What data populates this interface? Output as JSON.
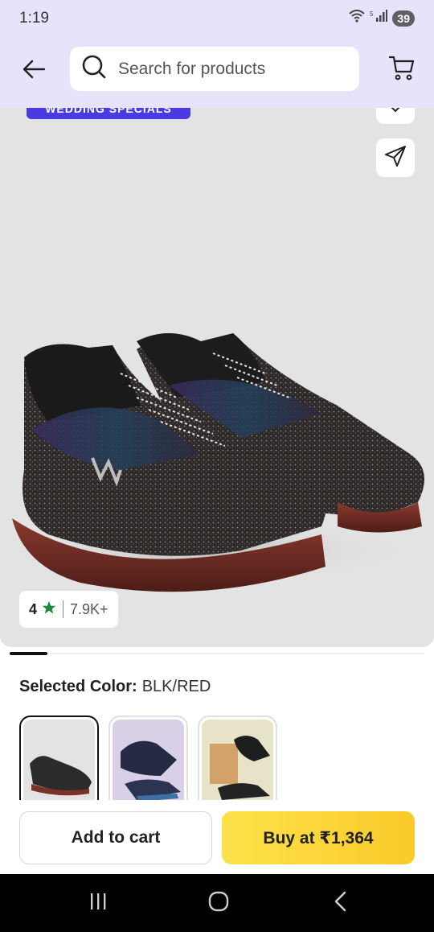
{
  "status_bar": {
    "time": "1:19",
    "signal_label": "5",
    "battery": "39"
  },
  "header": {
    "search_placeholder": "Search for products",
    "back_icon": "arrow-left-icon",
    "cart_icon": "cart-icon"
  },
  "product": {
    "promo_badge": "WEDDING SPECIALS",
    "rating": {
      "value": "4",
      "count": "7.9K+",
      "star_color": "#1a8a3e"
    },
    "image_indicator": {
      "current": 1
    }
  },
  "color_selection": {
    "label": "Selected Color:",
    "value": "BLK/RED",
    "swatches": [
      {
        "name": "BLK/RED",
        "selected": true
      },
      {
        "name": "Navy/Blue",
        "selected": false
      },
      {
        "name": "Black/Grey",
        "selected": false
      }
    ]
  },
  "actions": {
    "add_to_cart": "Add to cart",
    "buy": "Buy at ₹1,364"
  },
  "colors": {
    "header_bg": "#e6e4fa",
    "badge_bg": "#4a3ae0",
    "buy_bg": "#fbd533"
  }
}
